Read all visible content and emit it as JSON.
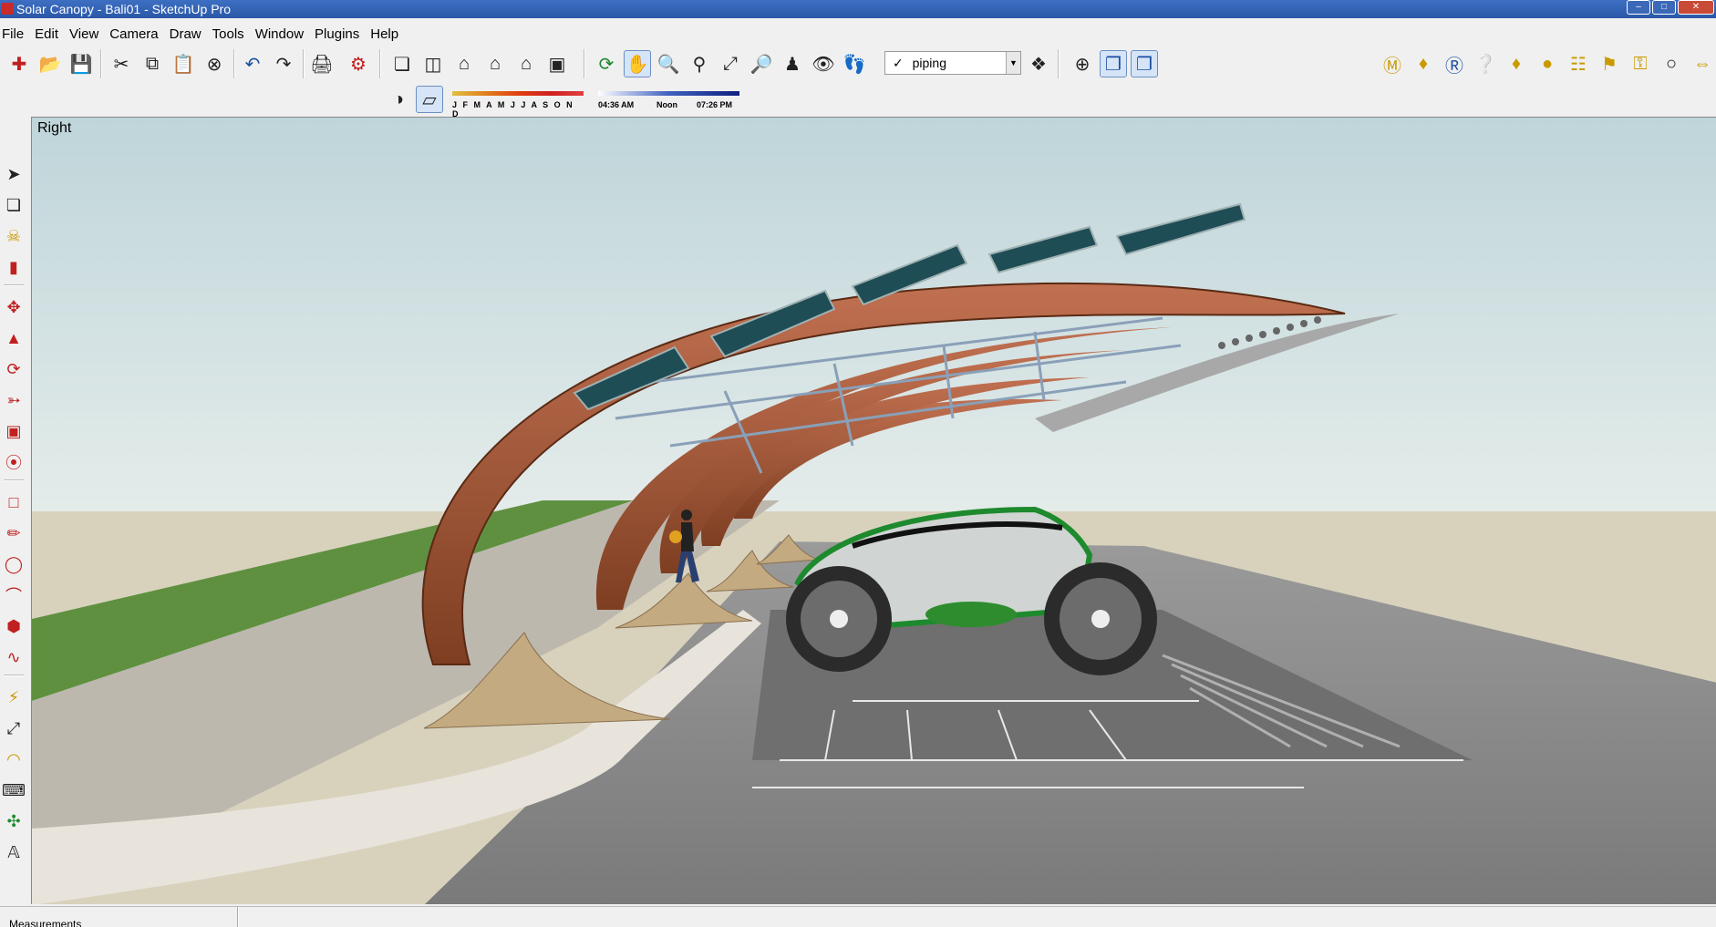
{
  "window": {
    "title": "Solar Canopy - Bali01 - SketchUp Pro",
    "minimize": "–",
    "maximize": "□",
    "close": "✕"
  },
  "menu": [
    "File",
    "Edit",
    "View",
    "Camera",
    "Draw",
    "Tools",
    "Window",
    "Plugins",
    "Help"
  ],
  "layers": {
    "current": "piping"
  },
  "shadows": {
    "months": "J F M A M J J A S O N D",
    "time_start": "04:36 AM",
    "time_mid": "Noon",
    "time_end": "07:26 PM"
  },
  "viewport": {
    "view_name": "Right"
  },
  "statusbar": {
    "measurements_label": "Measurements"
  },
  "colors": {
    "sky": "#c9dde0",
    "ground": "#d9d4bf",
    "arch": "#a2593a",
    "panel": "#1f4d55",
    "grass": "#5a8f3a",
    "asphalt": "#8e8e8e"
  }
}
